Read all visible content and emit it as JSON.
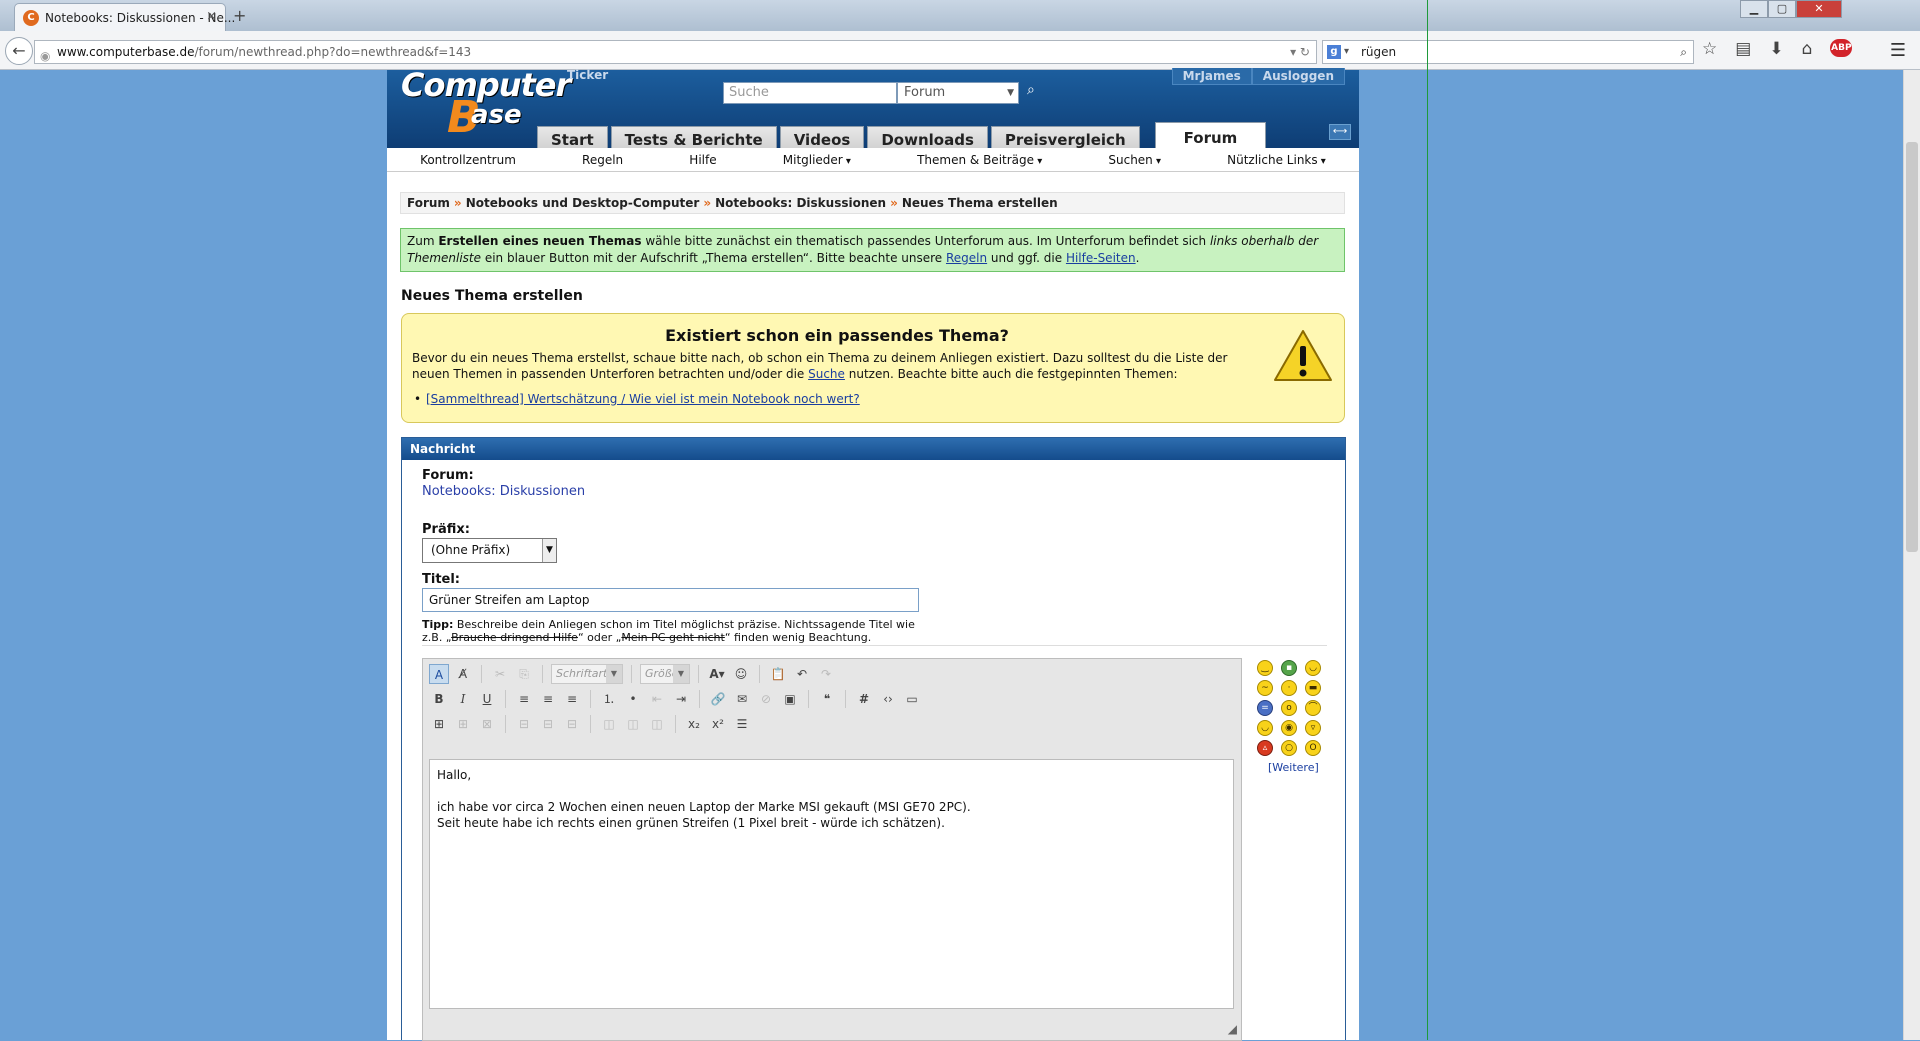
{
  "browser": {
    "tab_title": "Notebooks: Diskussionen - Ne...",
    "tab_close": "×",
    "new_tab": "+",
    "url_host": "www.computerbase.de",
    "url_path": "/forum/newthread.php?do=newthread&f=143",
    "search_value": "rügen",
    "win_min": "▁",
    "win_max": "▢",
    "win_close": "✕"
  },
  "header": {
    "logo_computer": "Computer",
    "logo_b": "B",
    "logo_ase": "ase",
    "ticker": "Ticker",
    "search_placeholder": "Suche",
    "search_scope": "Forum",
    "user": "MrJames",
    "logout": "Ausloggen",
    "tabs": [
      "Start",
      "Tests & Berichte",
      "Videos",
      "Downloads",
      "Preisvergleich"
    ],
    "active_tab": "Forum"
  },
  "subnav": [
    "Kontrollzentrum",
    "Regeln",
    "Hilfe",
    "Mitglieder",
    "Themen & Beiträge",
    "Suchen",
    "Nützliche Links"
  ],
  "breadcrumb": [
    "Forum",
    "Notebooks und Desktop-Computer",
    "Notebooks: Diskussionen",
    "Neues Thema erstellen"
  ],
  "breadcrumb_sep": "»",
  "info": {
    "t1": "Zum ",
    "t2": "Erstellen eines neuen Themas",
    "t3": " wähle bitte zunächst ein thematisch passendes Unterforum aus. Im Unterforum befindet sich ",
    "t4": "links oberhalb der Themenliste",
    "t5": " ein blauer Button mit der Aufschrift „Thema erstellen“. Bitte beachte unsere ",
    "link1": "Regeln",
    "t6": " und ggf. die ",
    "link2": "Hilfe-Seiten",
    "t7": "."
  },
  "page_heading": "Neues Thema erstellen",
  "notice": {
    "title": "Existiert schon ein passendes Thema?",
    "p1": "Bevor du ein neues Thema erstellst, schaue bitte nach, ob schon ein Thema zu deinem Anliegen existiert. Dazu solltest du die Liste der neuen Themen in passenden Unterforen betrachten und/oder die ",
    "link": "Suche",
    "p2": " nutzen. Beachte bitte auch die festgepinnten Themen:",
    "sticky": "[Sammelthread] Wertschätzung / Wie viel ist mein Notebook noch wert?"
  },
  "form": {
    "panel_title": "Nachricht",
    "forum_label": "Forum:",
    "forum_value": "Notebooks: Diskussionen",
    "prefix_label": "Präfix:",
    "prefix_value": "(Ohne Präfix)",
    "title_label": "Titel:",
    "title_value": "Grüner Streifen am Laptop",
    "tip_label": "Tipp:",
    "tip1": " Beschreibe dein Anliegen schon im Titel möglichst präzise. Nichtssagende Titel wie z.B. „",
    "tip_bad1": "Brauche dringend Hilfe",
    "tip2": "“ oder „",
    "tip_bad2": "Mein PC geht nicht",
    "tip3": "“ finden wenig Beachtung."
  },
  "editor": {
    "font_placeholder": "Schriftart",
    "size_placeholder": "Größe",
    "message": "Hallo,\n\nich habe vor circa 2 Wochen einen neuen Laptop der Marke MSI gekauft (MSI GE70 2PC).\nSeit heute habe ich rechts einen grünen Streifen (1 Pixel breit - würde ich schätzen)."
  },
  "smilies_more": "[Weitere]",
  "colors": {
    "header_blue": "#0e3d74",
    "accent_orange": "#e06a1f",
    "info_green": "#c8f2c0",
    "notice_yellow": "#fff8b3"
  }
}
